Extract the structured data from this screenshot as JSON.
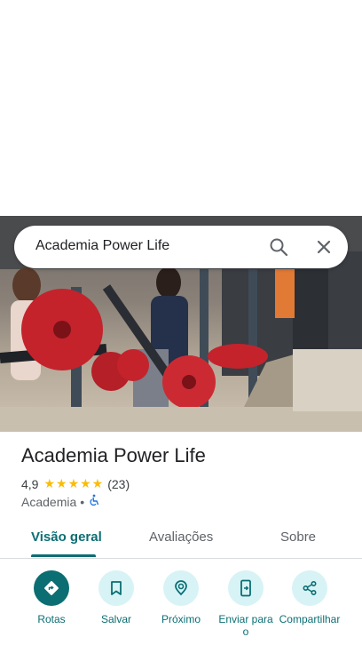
{
  "search": {
    "query": "Academia Power Life"
  },
  "place": {
    "name": "Academia Power Life",
    "rating": "4,9",
    "stars": "★★★★★",
    "review_count": "(23)",
    "category": "Academia",
    "separator": "•"
  },
  "tabs": [
    {
      "label": "Visão geral",
      "active": true
    },
    {
      "label": "Avaliações",
      "active": false
    },
    {
      "label": "Sobre",
      "active": false
    }
  ],
  "actions": [
    {
      "label": "Rotas",
      "icon": "directions-icon"
    },
    {
      "label": "Salvar",
      "icon": "bookmark-icon"
    },
    {
      "label": "Próximo",
      "icon": "nearby-icon"
    },
    {
      "label": "Enviar para o",
      "icon": "send-to-phone-icon"
    },
    {
      "label": "Compartilhar",
      "icon": "share-icon"
    }
  ],
  "colors": {
    "accent": "#0b6e73",
    "accent_light": "#d7f3f6",
    "star": "#fbbc04"
  }
}
